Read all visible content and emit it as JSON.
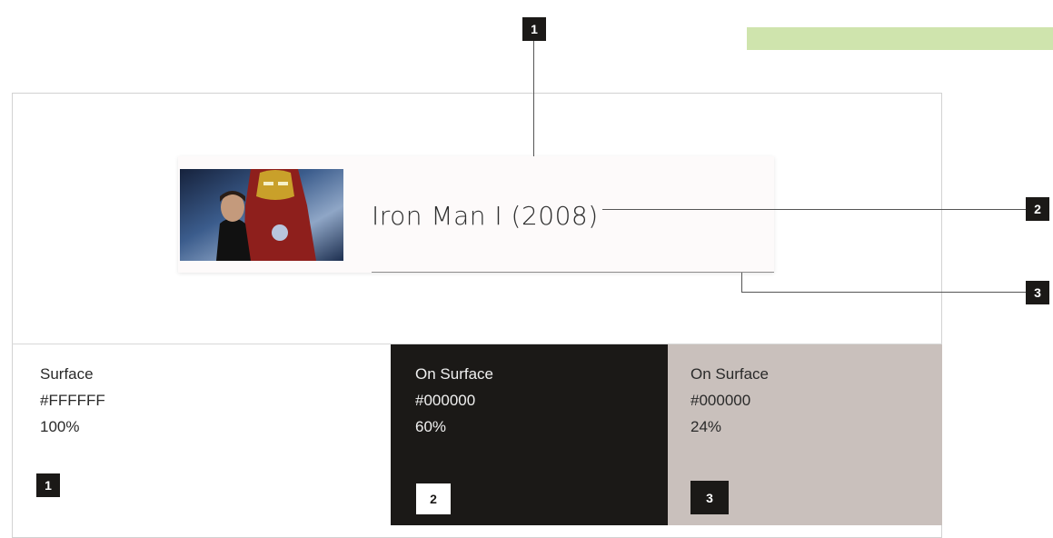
{
  "callouts": {
    "top": "1",
    "right_title": "2",
    "right_underline": "3"
  },
  "card": {
    "title": "Iron Man I (2008)",
    "image_icon": "movie-poster-image"
  },
  "swatches": [
    {
      "name": "Surface",
      "hex": "#FFFFFF",
      "opacity": "100%",
      "marker": "1"
    },
    {
      "name": "On Surface",
      "hex": "#000000",
      "opacity": "60%",
      "marker": "2"
    },
    {
      "name": "On Surface",
      "hex": "#000000",
      "opacity": "24%",
      "marker": "3"
    }
  ],
  "colors": {
    "accent_bar": "#cfe4ad",
    "surface": "#ffffff",
    "on_surface_dark": "#1b1917",
    "on_surface_light": "#c9c0bc"
  }
}
